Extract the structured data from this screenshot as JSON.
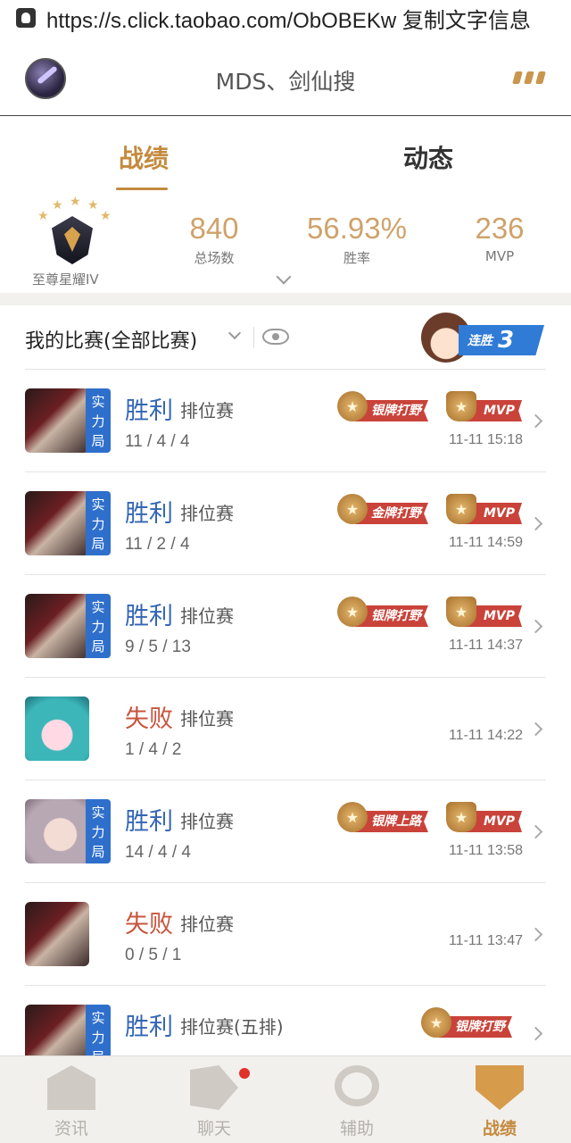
{
  "url_bar": {
    "text": "https://s.click.taobao.com/ObOBEKw 复制文字信息"
  },
  "header": {
    "title": "MDS、剑仙搜"
  },
  "tabs": [
    {
      "label": "战绩"
    },
    {
      "label": "动态"
    }
  ],
  "profile": {
    "rank_name": "至尊星耀IV",
    "stats": [
      {
        "value": "840",
        "caption": "总场数"
      },
      {
        "value": "56.93%",
        "caption": "胜率"
      },
      {
        "value": "236",
        "caption": "MVP"
      }
    ]
  },
  "match_list": {
    "filter_label": "我的比赛(全部比赛)",
    "streak": {
      "label": "连胜",
      "count": "3"
    }
  },
  "matches": [
    {
      "result": "胜利",
      "mode": "排位赛",
      "kda": "11 / 4 / 4",
      "time": "11-11 15:18",
      "tag": "实力局",
      "badge": "银牌打野",
      "mvp": "MVP"
    },
    {
      "result": "胜利",
      "mode": "排位赛",
      "kda": "11 / 2 / 4",
      "time": "11-11 14:59",
      "tag": "实力局",
      "badge": "金牌打野",
      "mvp": "MVP"
    },
    {
      "result": "胜利",
      "mode": "排位赛",
      "kda": "9 / 5 / 13",
      "time": "11-11 14:37",
      "tag": "实力局",
      "badge": "银牌打野",
      "mvp": "MVP"
    },
    {
      "result": "失败",
      "mode": "排位赛",
      "kda": "1 / 4 / 2",
      "time": "11-11 14:22"
    },
    {
      "result": "胜利",
      "mode": "排位赛",
      "kda": "14 / 4 / 4",
      "time": "11-11 13:58",
      "tag": "实力局",
      "badge": "银牌上路",
      "mvp": "MVP"
    },
    {
      "result": "失败",
      "mode": "排位赛",
      "kda": "0 / 5 / 1",
      "time": "11-11 13:47"
    },
    {
      "result": "胜利",
      "mode": "排位赛(五排)",
      "tag": "实力局",
      "badge": "银牌打野"
    }
  ],
  "bottom_nav": [
    {
      "label": "资讯"
    },
    {
      "label": "聊天"
    },
    {
      "label": "辅助"
    },
    {
      "label": "战绩"
    }
  ],
  "colors": {
    "accent": "#c48a3f",
    "win": "#3466b5",
    "lose": "#c8543e",
    "tag_blue": "#2f6fcc",
    "ribbon_red": "#c9433a"
  }
}
